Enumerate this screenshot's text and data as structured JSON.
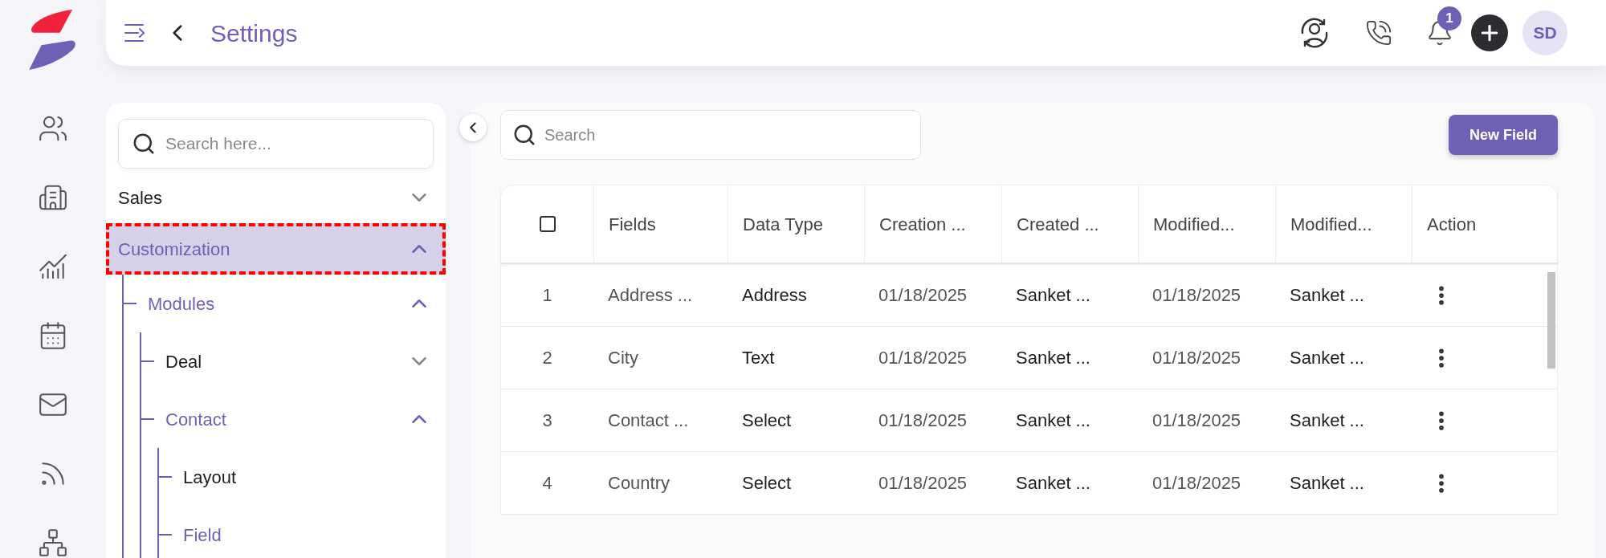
{
  "header": {
    "title": "Settings",
    "notification_count": "1",
    "avatar_initials": "SD"
  },
  "settings_nav": {
    "search_placeholder": "Search here...",
    "items": [
      {
        "label": "Sales",
        "kind": "group",
        "expanded": false,
        "active": false,
        "selected": false,
        "annotated": false
      },
      {
        "label": "Customization",
        "kind": "group",
        "expanded": true,
        "active": true,
        "selected": true,
        "annotated": true,
        "children": [
          {
            "label": "Modules",
            "kind": "group",
            "expanded": true,
            "active": true,
            "selected": false,
            "annotated": false,
            "children": [
              {
                "label": "Deal",
                "kind": "group",
                "expanded": false,
                "active": false,
                "selected": false,
                "annotated": false
              },
              {
                "label": "Contact",
                "kind": "group",
                "expanded": true,
                "active": true,
                "selected": false,
                "annotated": false,
                "children": [
                  {
                    "label": "Layout",
                    "kind": "leaf",
                    "active": false,
                    "selected": false,
                    "annotated": false
                  },
                  {
                    "label": "Field",
                    "kind": "leaf",
                    "active": true,
                    "selected": false,
                    "annotated": false
                  }
                ]
              }
            ]
          }
        ]
      }
    ]
  },
  "toolbar": {
    "search_placeholder": "Search",
    "new_button": "New Field"
  },
  "table": {
    "select_all_checked": false,
    "columns": [
      "Fields",
      "Data Type",
      "Creation ...",
      "Created ...",
      "Modified...",
      "Modified...",
      "Action"
    ],
    "rows": [
      {
        "index": "1",
        "cells": [
          "Address ...",
          "Address",
          "01/18/2025",
          "Sanket ...",
          "01/18/2025",
          "Sanket ..."
        ]
      },
      {
        "index": "2",
        "cells": [
          "City",
          "Text",
          "01/18/2025",
          "Sanket ...",
          "01/18/2025",
          "Sanket ..."
        ]
      },
      {
        "index": "3",
        "cells": [
          "Contact ...",
          "Select",
          "01/18/2025",
          "Sanket ...",
          "01/18/2025",
          "Sanket ..."
        ]
      },
      {
        "index": "4",
        "cells": [
          "Country",
          "Select",
          "01/18/2025",
          "Sanket ...",
          "01/18/2025",
          "Sanket ..."
        ]
      }
    ]
  }
}
